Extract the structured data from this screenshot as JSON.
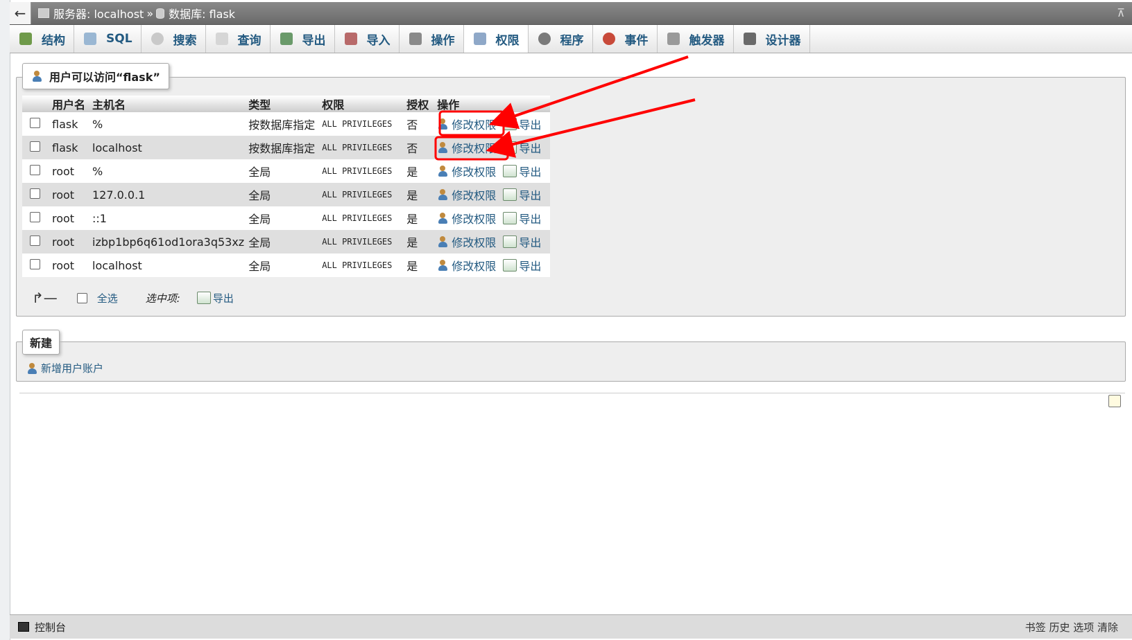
{
  "breadcrumb": {
    "server_label": "服务器: localhost",
    "separator": "»",
    "database_label": "数据库: flask"
  },
  "tabs": [
    {
      "label": "结构",
      "icon": "structure-icon"
    },
    {
      "label": "SQL",
      "icon": "sql-icon"
    },
    {
      "label": "搜索",
      "icon": "search-icon"
    },
    {
      "label": "查询",
      "icon": "query-icon"
    },
    {
      "label": "导出",
      "icon": "export-icon"
    },
    {
      "label": "导入",
      "icon": "import-icon"
    },
    {
      "label": "操作",
      "icon": "wrench-icon"
    },
    {
      "label": "权限",
      "icon": "privileges-icon",
      "active": true
    },
    {
      "label": "程序",
      "icon": "routines-icon"
    },
    {
      "label": "事件",
      "icon": "events-icon"
    },
    {
      "label": "触发器",
      "icon": "triggers-icon"
    },
    {
      "label": "设计器",
      "icon": "designer-icon"
    }
  ],
  "users_panel": {
    "legend": "用户可以访问“flask”",
    "headers": [
      "用户名",
      "主机名",
      "类型",
      "权限",
      "授权",
      "操作"
    ],
    "rows": [
      {
        "user": "flask",
        "host": "%",
        "type": "按数据库指定",
        "privileges": "ALL PRIVILEGES",
        "grant": "否"
      },
      {
        "user": "flask",
        "host": "localhost",
        "type": "按数据库指定",
        "privileges": "ALL PRIVILEGES",
        "grant": "否"
      },
      {
        "user": "root",
        "host": "%",
        "type": "全局",
        "privileges": "ALL PRIVILEGES",
        "grant": "是"
      },
      {
        "user": "root",
        "host": "127.0.0.1",
        "type": "全局",
        "privileges": "ALL PRIVILEGES",
        "grant": "是"
      },
      {
        "user": "root",
        "host": "::1",
        "type": "全局",
        "privileges": "ALL PRIVILEGES",
        "grant": "是"
      },
      {
        "user": "root",
        "host": "izbp1bp6q61od1ora3q53xz",
        "type": "全局",
        "privileges": "ALL PRIVILEGES",
        "grant": "是"
      },
      {
        "user": "root",
        "host": "localhost",
        "type": "全局",
        "privileges": "ALL PRIVILEGES",
        "grant": "是"
      }
    ],
    "edit_label": "修改权限",
    "export_label": "导出",
    "select_all": "全选",
    "with_selected": "选中项:",
    "bulk_export": "导出"
  },
  "new_panel": {
    "legend": "新建",
    "add_user": "新增用户账户"
  },
  "console": {
    "label": "控制台",
    "right_text": "书签 历史 选项 清除"
  },
  "colors": {
    "link": "#235a81",
    "highlight": "#ff0000"
  }
}
